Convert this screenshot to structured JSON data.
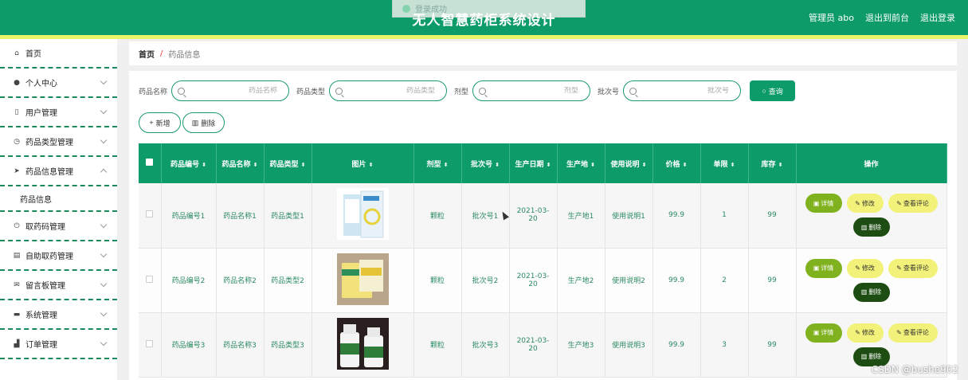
{
  "header": {
    "title": "无人智慧药柜系统设计",
    "user_label": "管理员 abo",
    "to_front_label": "退出到前台",
    "logout_label": "退出登录",
    "toast_text": "登录成功"
  },
  "sidebar": {
    "items": [
      {
        "label": "首页",
        "icon": "home-icon",
        "chevron": false
      },
      {
        "label": "个人中心",
        "icon": "user-icon",
        "chevron": true
      },
      {
        "label": "用户管理",
        "icon": "user-manage-icon",
        "chevron": true
      },
      {
        "label": "药品类型管理",
        "icon": "compass-icon",
        "chevron": true
      },
      {
        "label": "药品信息管理",
        "icon": "send-icon",
        "chevron": true,
        "expanded": true
      },
      {
        "label": "取药码管理",
        "icon": "power-icon",
        "chevron": true
      },
      {
        "label": "自助取药管理",
        "icon": "chart-icon",
        "chevron": true
      },
      {
        "label": "留言板管理",
        "icon": "message-icon",
        "chevron": true
      },
      {
        "label": "系统管理",
        "icon": "system-icon",
        "chevron": true
      },
      {
        "label": "订单管理",
        "icon": "order-icon",
        "chevron": true
      }
    ],
    "sub_item": "药品信息"
  },
  "breadcrumb": {
    "home": "首页",
    "current": "药品信息"
  },
  "search": {
    "fields": [
      {
        "label": "药品名称",
        "placeholder": "药品名称"
      },
      {
        "label": "药品类型",
        "placeholder": "药品类型"
      },
      {
        "label": "剂型",
        "placeholder": "剂型"
      },
      {
        "label": "批次号",
        "placeholder": "批次号"
      }
    ],
    "button_label": "查询"
  },
  "actions": {
    "add_label": "新增",
    "delete_label": "删除"
  },
  "table": {
    "headers": [
      "药品编号",
      "药品名称",
      "药品类型",
      "图片",
      "剂型",
      "批次号",
      "生产日期",
      "生产地",
      "使用说明",
      "价格",
      "单限",
      "库存",
      "操作"
    ],
    "rows": [
      {
        "code": "药品编号1",
        "name": "药品名称1",
        "type": "药品类型1",
        "form": "颗粒",
        "batch": "批次号1",
        "date": "2021-03-20",
        "origin": "生产地1",
        "usage": "使用说明1",
        "price": "99.9",
        "limit": "1",
        "stock": "99"
      },
      {
        "code": "药品编号2",
        "name": "药品名称2",
        "type": "药品类型2",
        "form": "颗粒",
        "batch": "批次号2",
        "date": "2021-03-20",
        "origin": "生产地2",
        "usage": "使用说明2",
        "price": "99.9",
        "limit": "2",
        "stock": "99"
      },
      {
        "code": "药品编号3",
        "name": "药品名称3",
        "type": "药品类型3",
        "form": "颗粒",
        "batch": "批次号3",
        "date": "2021-03-20",
        "origin": "生产地3",
        "usage": "使用说明3",
        "price": "99.9",
        "limit": "3",
        "stock": "99"
      }
    ],
    "row_actions": {
      "detail": "详情",
      "edit": "修改",
      "comment": "查看评论",
      "delete": "删除"
    }
  },
  "watermark": "CSDN @bushe902",
  "colors": {
    "primary": "#0e9b6a",
    "stripe": "#e9f46a",
    "detail_btn": "#7fb21e",
    "edit_btn": "#f2f27a",
    "delete_btn": "#1d4d12"
  }
}
